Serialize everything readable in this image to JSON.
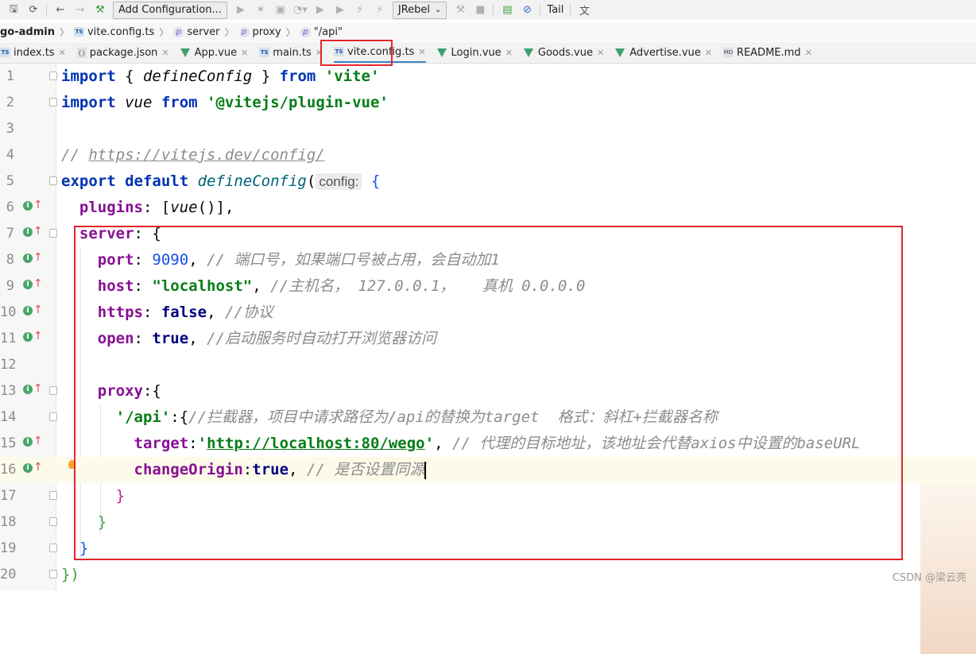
{
  "toolbar": {
    "add_config_label": "Add Configuration...",
    "jrebel_label": "JRebel",
    "tail_label": "Tail"
  },
  "breadcrumb": [
    "go-admin",
    "vite.config.ts",
    "server",
    "proxy",
    "\"/api\""
  ],
  "tabs": [
    {
      "label": "index.ts",
      "type": "ts"
    },
    {
      "label": "package.json",
      "type": "json"
    },
    {
      "label": "App.vue",
      "type": "vue"
    },
    {
      "label": "main.ts",
      "type": "ts"
    },
    {
      "label": "vite.config.ts",
      "type": "ts",
      "active": true
    },
    {
      "label": "Login.vue",
      "type": "vue"
    },
    {
      "label": "Goods.vue",
      "type": "vue"
    },
    {
      "label": "Advertise.vue",
      "type": "vue"
    },
    {
      "label": "README.md",
      "type": "md"
    }
  ],
  "editor": {
    "line_numbers": [
      "1",
      "2",
      "3",
      "4",
      "5",
      "6",
      "7",
      "8",
      "9",
      "10",
      "11",
      "12",
      "13",
      "14",
      "15",
      "16",
      "17",
      "18",
      "19",
      "20"
    ],
    "code": {
      "l1_import": "import",
      "l1_open": " { ",
      "l1_define": "defineConfig",
      "l1_close": " } ",
      "l1_from": "from",
      "l1_str": " 'vite'",
      "l2_import": "import",
      "l2_vue": " vue ",
      "l2_from": "from",
      "l2_str": " '@vitejs/plugin-vue'",
      "l4_comment": "// ",
      "l4_url": "https://vitejs.dev/config/",
      "l5_export": "export default",
      "l5_fn": " defineConfig",
      "l5_paren": "(",
      "l5_hint": "config:",
      "l5_brace": " {",
      "l6_prop": "plugins",
      "l6_mid": ": [",
      "l6_fn": "vue",
      "l6_end": "()],",
      "l7_prop": "server",
      "l7_end": ": {",
      "l8_prop": "port",
      "l8_colon": ": ",
      "l8_num": "9090",
      "l8_comma": ", ",
      "l8_cmt": "// 端口号，如果端口号被占用，会自动加1",
      "l9_prop": "host",
      "l9_colon": ": ",
      "l9_str": "\"localhost\"",
      "l9_comma": ", ",
      "l9_cmt": "//主机名， 127.0.0.1，   真机 0.0.0.0",
      "l10_prop": "https",
      "l10_colon": ": ",
      "l10_val": "false",
      "l10_comma": ", ",
      "l10_cmt": "//协议",
      "l11_prop": "open",
      "l11_colon": ": ",
      "l11_val": "true",
      "l11_comma": ", ",
      "l11_cmt": "//启动服务时自动打开浏览器访问",
      "l13_prop": "proxy",
      "l13_end": ":{",
      "l14_str": "'/api'",
      "l14_colon": ":{",
      "l14_cmt": "//拦截器，项目中请求路径为/api的替换为target  格式：斜杠+拦截器名称",
      "l15_prop": "target",
      "l15_colon": ":",
      "l15_str_q1": "'",
      "l15_url": "http://localhost:80/wego",
      "l15_str_q2": "'",
      "l15_comma": ", ",
      "l15_cmt": "// 代理的目标地址，该地址会代替axios中设置的baseURL",
      "l16_prop": "changeOrigin",
      "l16_colon": ":",
      "l16_val": "true",
      "l16_comma": ", ",
      "l16_cmt": "// 是否设置同源",
      "l17_close": "}",
      "l18_close": "}",
      "l19_close": "}",
      "l20_close": "})"
    }
  },
  "watermark": "CSDN @梁云亮"
}
